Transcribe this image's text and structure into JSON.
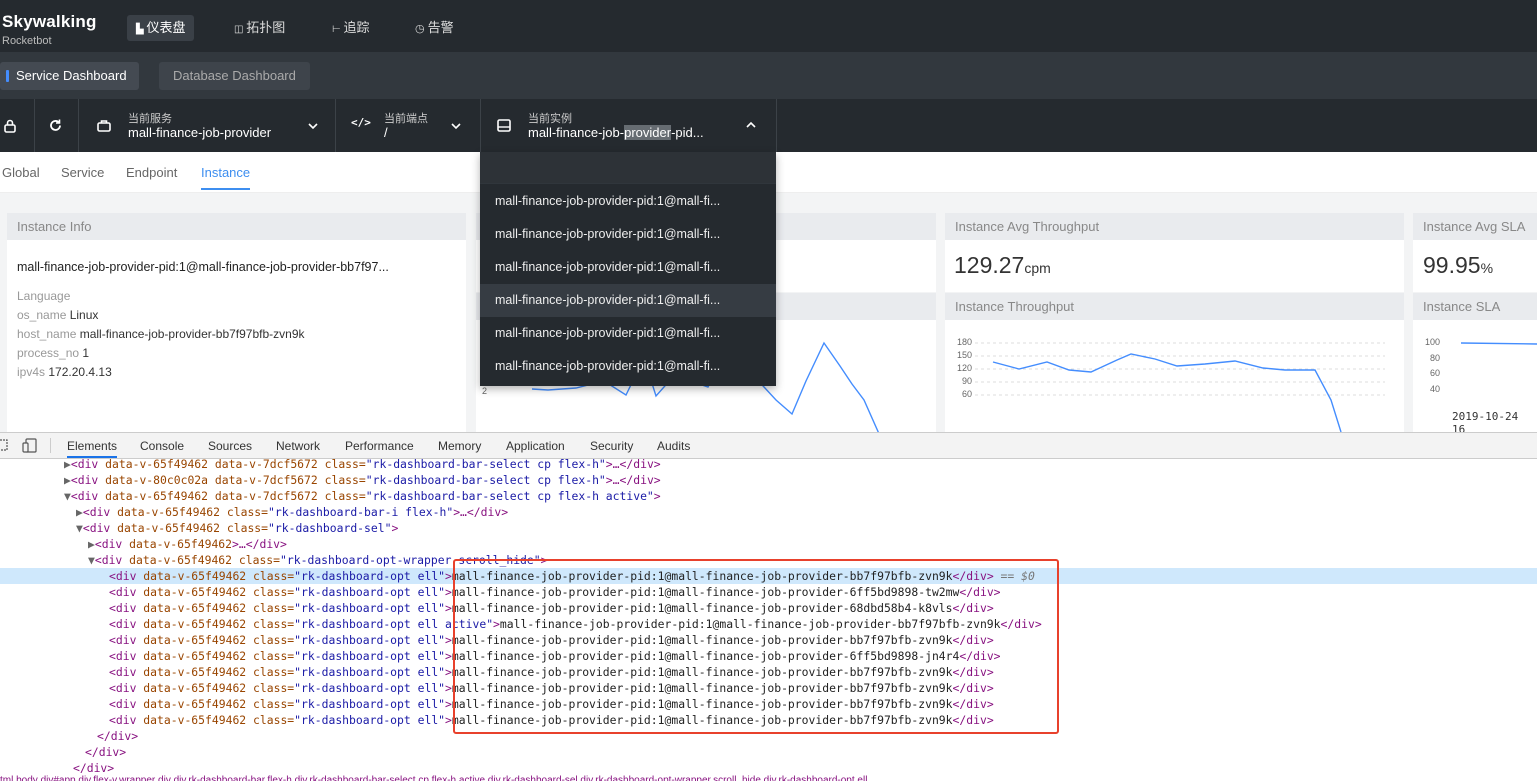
{
  "header": {
    "logo": "Skywalking",
    "logo_sub": "Rocketbot",
    "nav": [
      {
        "label": "仪表盘",
        "icon": "chart-icon",
        "active": true
      },
      {
        "label": "拓扑图",
        "icon": "topology-icon",
        "active": false
      },
      {
        "label": "追踪",
        "icon": "trace-icon",
        "active": false
      },
      {
        "label": "告警",
        "icon": "alarm-icon",
        "active": false
      }
    ]
  },
  "dashboard_tabs": [
    "Service Dashboard",
    "Database Dashboard"
  ],
  "selectors": {
    "service": {
      "label": "当前服务",
      "value": "mall-finance-job-provider"
    },
    "endpoint": {
      "label": "当前端点",
      "value": "/"
    },
    "instance": {
      "label": "当前实例",
      "value_pre": "mall-finance-job-",
      "value_hl": "provider",
      "value_post": "-pid..."
    }
  },
  "scope_tabs": [
    "Global",
    "Service",
    "Endpoint",
    "Instance"
  ],
  "active_scope": "Instance",
  "instance_info": {
    "title": "Instance Info",
    "name": "mall-finance-job-provider-pid:1@mall-finance-job-provider-bb7f97...",
    "rows": [
      {
        "k": "Language",
        "v": ""
      },
      {
        "k": "os_name",
        "v": "Linux"
      },
      {
        "k": "host_name",
        "v": "mall-finance-job-provider-bb7f97bfb-zvn9k"
      },
      {
        "k": "process_no",
        "v": "1"
      },
      {
        "k": "ipv4s",
        "v": "172.20.4.13"
      }
    ]
  },
  "throughput_avg": {
    "title": "Instance Avg Throughput",
    "value": "129.27",
    "unit": "cpm"
  },
  "sla_avg": {
    "title": "Instance Avg SLA",
    "value": "99.95",
    "unit": "%"
  },
  "throughput_chart": {
    "title": "Instance Throughput",
    "yticks": [
      "180",
      "150",
      "120",
      "90",
      "60"
    ]
  },
  "sla_chart": {
    "title": "Instance SLA",
    "yticks": [
      "100",
      "80",
      "60",
      "40"
    ]
  },
  "left_chart": {
    "yticks": [
      "2"
    ]
  },
  "timestamp": "2019-10-24 16",
  "dropdown_items": [
    "mall-finance-job-provider-pid:1@mall-fi...",
    "mall-finance-job-provider-pid:1@mall-fi...",
    "mall-finance-job-provider-pid:1@mall-fi...",
    "mall-finance-job-provider-pid:1@mall-fi...",
    "mall-finance-job-provider-pid:1@mall-fi...",
    "mall-finance-job-provider-pid:1@mall-fi..."
  ],
  "devtools": {
    "tabs": [
      "Elements",
      "Console",
      "Sources",
      "Network",
      "Performance",
      "Memory",
      "Application",
      "Security",
      "Audits"
    ],
    "lines": [
      {
        "indent": 0,
        "tri": "▶",
        "attrs": "data-v-65f49462 data-v-7dcf5672 class=",
        "cls": "rk-dashboard-bar-select cp flex-h",
        "tail": ">…</div>"
      },
      {
        "indent": 0,
        "tri": "▶",
        "attrs": "data-v-80c0c02a data-v-7dcf5672 class=",
        "cls": "rk-dashboard-bar-select cp flex-h",
        "tail": ">…</div>"
      },
      {
        "indent": 0,
        "tri": "▼",
        "attrs": "data-v-65f49462 data-v-7dcf5672 class=",
        "cls": "rk-dashboard-bar-select cp flex-h active",
        "tail": ">"
      },
      {
        "indent": 1,
        "tri": "▶",
        "attrs": "data-v-65f49462 class=",
        "cls": "rk-dashboard-bar-i flex-h",
        "tail": ">…</div>"
      },
      {
        "indent": 1,
        "tri": "▼",
        "attrs": "data-v-65f49462 class=",
        "cls": "rk-dashboard-sel",
        "tail": ">"
      },
      {
        "indent": 2,
        "tri": "▶",
        "attrs": "data-v-65f49462",
        "cls": "",
        "tail": ">…</div>"
      },
      {
        "indent": 2,
        "tri": "▼",
        "attrs": "data-v-65f49462 class=",
        "cls": "rk-dashboard-opt-wrapper scroll_hide",
        "tail": ">"
      }
    ],
    "opt_prefix": "data-v-65f49462 class=",
    "opt_lines": [
      {
        "cls": "rk-dashboard-opt ell",
        "text": "mall-finance-job-provider-pid:1@mall-finance-job-provider-bb7f97bfb-zvn9k",
        "sel": true,
        "suffix": " == $0"
      },
      {
        "cls": "rk-dashboard-opt ell",
        "text": "mall-finance-job-provider-pid:1@mall-finance-job-provider-6ff5bd9898-tw2mw",
        "sel": false,
        "suffix": ""
      },
      {
        "cls": "rk-dashboard-opt ell",
        "text": "mall-finance-job-provider-pid:1@mall-finance-job-provider-68dbd58b4-k8vls",
        "sel": false,
        "suffix": ""
      },
      {
        "cls": "rk-dashboard-opt ell active",
        "text": "mall-finance-job-provider-pid:1@mall-finance-job-provider-bb7f97bfb-zvn9k",
        "sel": false,
        "suffix": ""
      },
      {
        "cls": "rk-dashboard-opt ell",
        "text": "mall-finance-job-provider-pid:1@mall-finance-job-provider-bb7f97bfb-zvn9k",
        "sel": false,
        "suffix": ""
      },
      {
        "cls": "rk-dashboard-opt ell",
        "text": "mall-finance-job-provider-pid:1@mall-finance-job-provider-6ff5bd9898-jn4r4",
        "sel": false,
        "suffix": ""
      },
      {
        "cls": "rk-dashboard-opt ell",
        "text": "mall-finance-job-provider-pid:1@mall-finance-job-provider-bb7f97bfb-zvn9k",
        "sel": false,
        "suffix": ""
      },
      {
        "cls": "rk-dashboard-opt ell",
        "text": "mall-finance-job-provider-pid:1@mall-finance-job-provider-bb7f97bfb-zvn9k",
        "sel": false,
        "suffix": ""
      },
      {
        "cls": "rk-dashboard-opt ell",
        "text": "mall-finance-job-provider-pid:1@mall-finance-job-provider-bb7f97bfb-zvn9k",
        "sel": false,
        "suffix": ""
      },
      {
        "cls": "rk-dashboard-opt ell",
        "text": "mall-finance-job-provider-pid:1@mall-finance-job-provider-bb7f97bfb-zvn9k",
        "sel": false,
        "suffix": ""
      }
    ],
    "close_lines": [
      "</div>",
      "</div>",
      "</div>"
    ],
    "breadcrumbs": "tml  body  div#app  div.flex-v.wrapper  div  div.rk-dashboard-bar.flex-h  div.rk-dashboard-bar-select.cp.flex-h.active  div.rk-dashboard-sel  div.rk-dashboard-opt-wrapper.scroll_hide  div.rk-dashboard-opt.ell"
  },
  "colors": {
    "accent": "#448dfe",
    "topbar": "#252a2f",
    "tabbar": "#32383e",
    "highlight_box": "#e8412c"
  }
}
